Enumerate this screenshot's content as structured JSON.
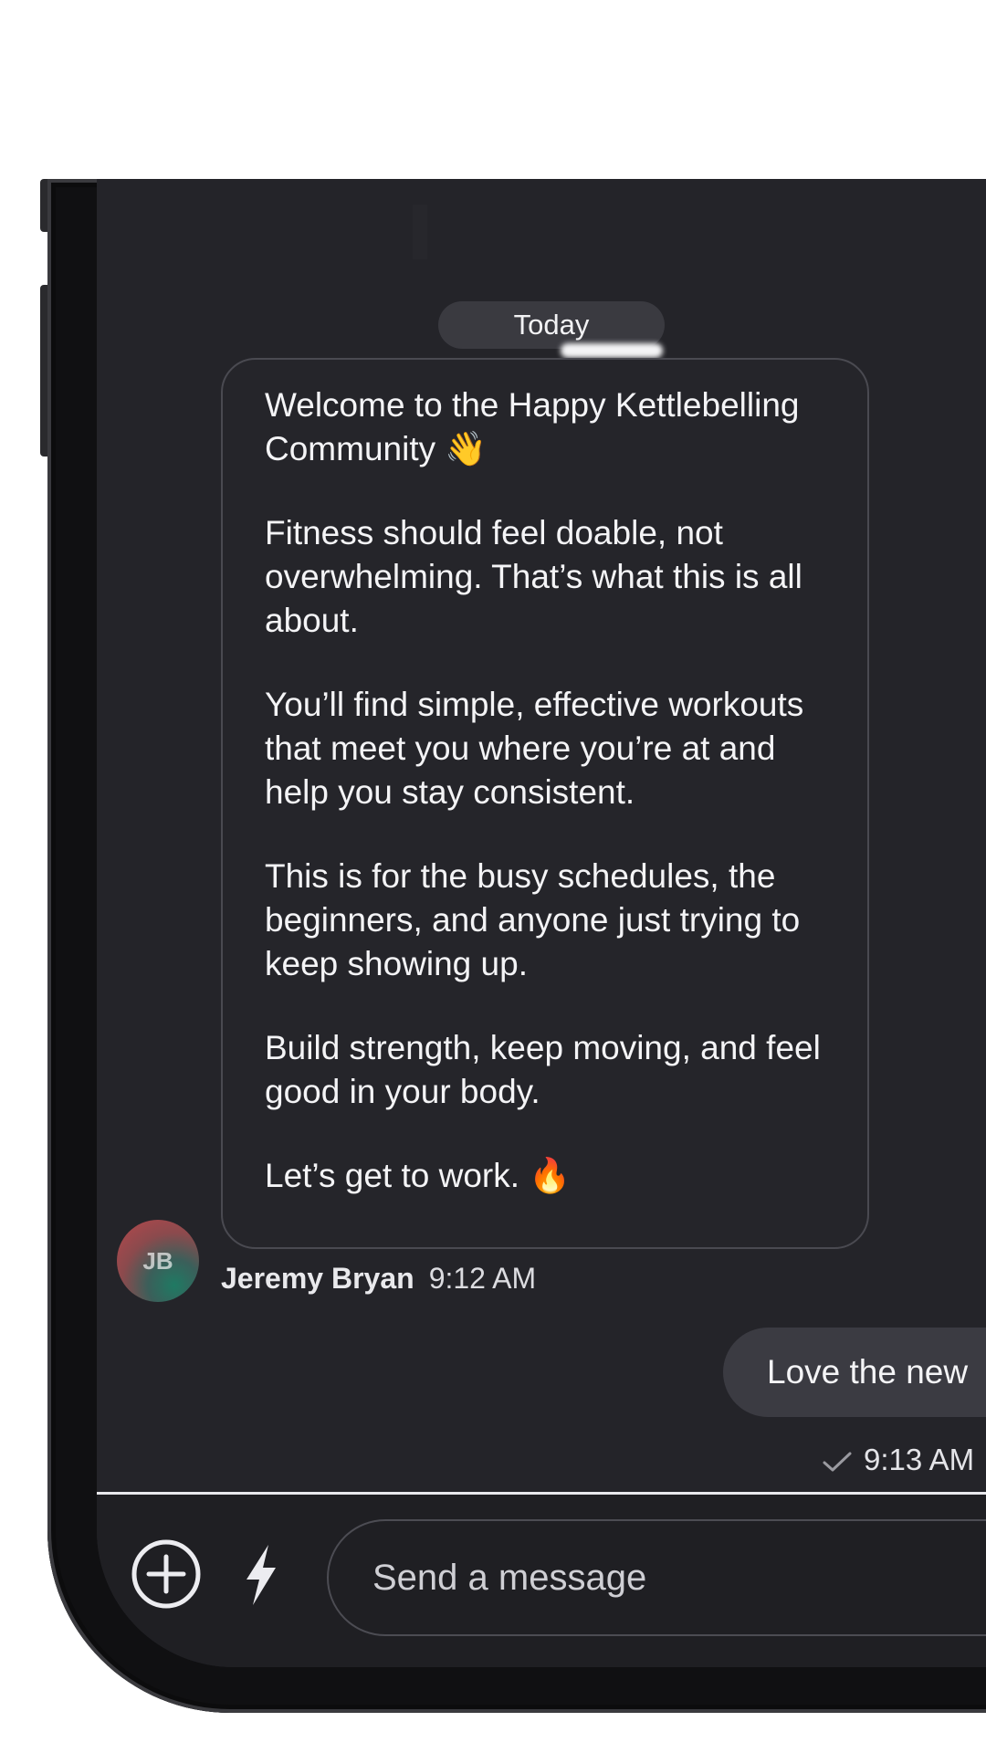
{
  "conversation": {
    "date_separator": "Today",
    "messages": [
      {
        "direction": "incoming",
        "paragraphs": [
          "Welcome to the Happy Kettlebelling Community 👋",
          "Fitness should feel doable, not overwhelming. That’s what this is all about.",
          "You’ll find simple, effective workouts that meet you where you’re at and help you stay consistent.",
          "This is for the busy schedules, the beginners, and anyone just trying to keep showing up.",
          "Build strength, keep moving, and feel good in your body.",
          "Let’s get to work. 🔥"
        ],
        "sender_initials": "JB",
        "sender_name": "Jeremy Bryan",
        "time": "9:12 AM"
      },
      {
        "direction": "outgoing",
        "text": "Love the new",
        "status_icon": "check-icon",
        "time": "9:13 AM"
      }
    ]
  },
  "composer": {
    "placeholder": "Send a message",
    "add_icon": "plus-circle-icon",
    "shortcut_icon": "lightning-bolt-icon"
  },
  "colors": {
    "screen_background": "#242429",
    "bubble_border": "#4a4a51",
    "outgoing_bubble": "#3b3b42",
    "text": "#f4f4f6"
  }
}
